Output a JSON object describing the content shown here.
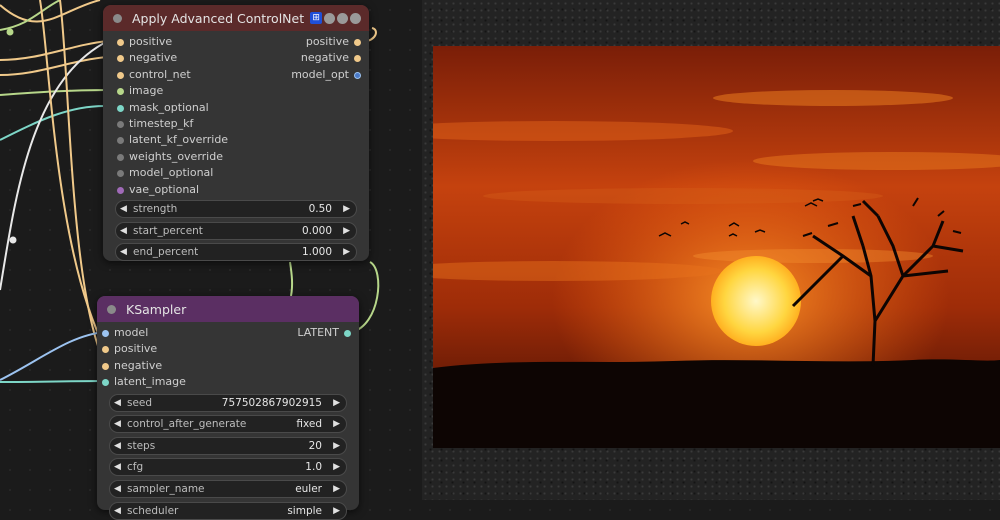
{
  "colors": {
    "advanced_header": "#5b2a2a",
    "ksampler_header": "#5b2f63",
    "badge_blue": "#1f4fd8",
    "conditioning": "#f0c98a",
    "image_slot": "#b7d78a",
    "mask_slot": "#7dd6c7",
    "latent_slot": "#e98fb3",
    "model_slot": "#9cc3f0",
    "vae_slot": "#d36b8a",
    "unused_slot": "#7a7a7a"
  },
  "advanced_node": {
    "title": "Apply Advanced ControlNet",
    "badge_icon": "grid-badge-icon",
    "inputs": [
      {
        "label": "positive"
      },
      {
        "label": "negative"
      },
      {
        "label": "control_net"
      },
      {
        "label": "image"
      },
      {
        "label": "mask_optional"
      },
      {
        "label": "timestep_kf"
      },
      {
        "label": "latent_kf_override"
      },
      {
        "label": "weights_override"
      },
      {
        "label": "model_optional"
      },
      {
        "label": "vae_optional"
      }
    ],
    "outputs": [
      {
        "label": "positive"
      },
      {
        "label": "negative"
      },
      {
        "label": "model_opt"
      }
    ],
    "widgets": [
      {
        "label": "strength",
        "value": "0.50"
      },
      {
        "label": "start_percent",
        "value": "0.000"
      },
      {
        "label": "end_percent",
        "value": "1.000"
      }
    ]
  },
  "ksampler_node": {
    "title": "KSampler",
    "inputs": [
      {
        "label": "model"
      },
      {
        "label": "positive"
      },
      {
        "label": "negative"
      },
      {
        "label": "latent_image"
      }
    ],
    "outputs": [
      {
        "label": "LATENT"
      }
    ],
    "widgets": [
      {
        "label": "seed",
        "value": "757502867902915"
      },
      {
        "label": "control_after_generate",
        "value": "fixed"
      },
      {
        "label": "steps",
        "value": "20"
      },
      {
        "label": "cfg",
        "value": "1.0"
      },
      {
        "label": "sampler_name",
        "value": "euler"
      },
      {
        "label": "scheduler",
        "value": "simple"
      }
    ]
  }
}
